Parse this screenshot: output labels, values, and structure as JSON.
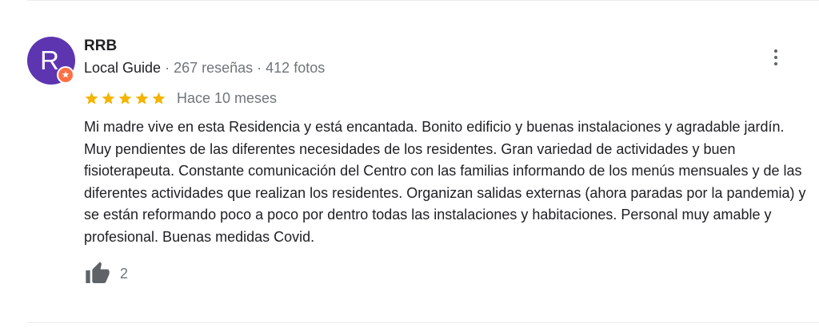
{
  "review": {
    "author": {
      "name": "RRB",
      "avatar_letter": "R",
      "avatar_color": "#5e35b1",
      "badge_color": "#ff7043",
      "badge_icon": "local-guide-star-icon",
      "guide_label": "Local Guide",
      "reviews_count": "267 reseñas",
      "photos_count": "412 fotos",
      "separator": " · "
    },
    "rating": 5,
    "rating_max": 5,
    "star_color": "#f4b400",
    "time": "Hace 10 meses",
    "text": "Mi madre vive en esta Residencia y está encantada. Bonito edificio y buenas instalaciones y agradable jardín. Muy pendientes de las diferentes necesidades de los residentes. Gran variedad de actividades y buen fisioterapeuta. Constante comunicación del Centro con las familias informando de los menús mensuales y de las diferentes actividades que realizan los residentes. Organizan salidas externas (ahora paradas por la pandemia) y se están reformando poco a poco por dentro todas las instalaciones y habitaciones. Personal muy amable y profesional. Buenas medidas Covid.",
    "likes": "2",
    "like_icon": "thumbs-up-icon",
    "menu_icon": "more-vert-icon"
  }
}
